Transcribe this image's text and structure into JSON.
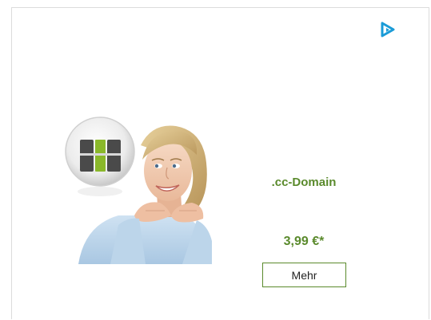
{
  "ad": {
    "product_title": ".cc-Domain",
    "price": "3,99 €*",
    "button_label": "Mehr",
    "icons": {
      "adchoices": "adchoices-icon",
      "brand_logo": "brand-logo-icon"
    },
    "colors": {
      "accent_green": "#5a8a2c",
      "adchoices_blue": "#1a9bd7",
      "border": "#dcdcdc"
    }
  }
}
